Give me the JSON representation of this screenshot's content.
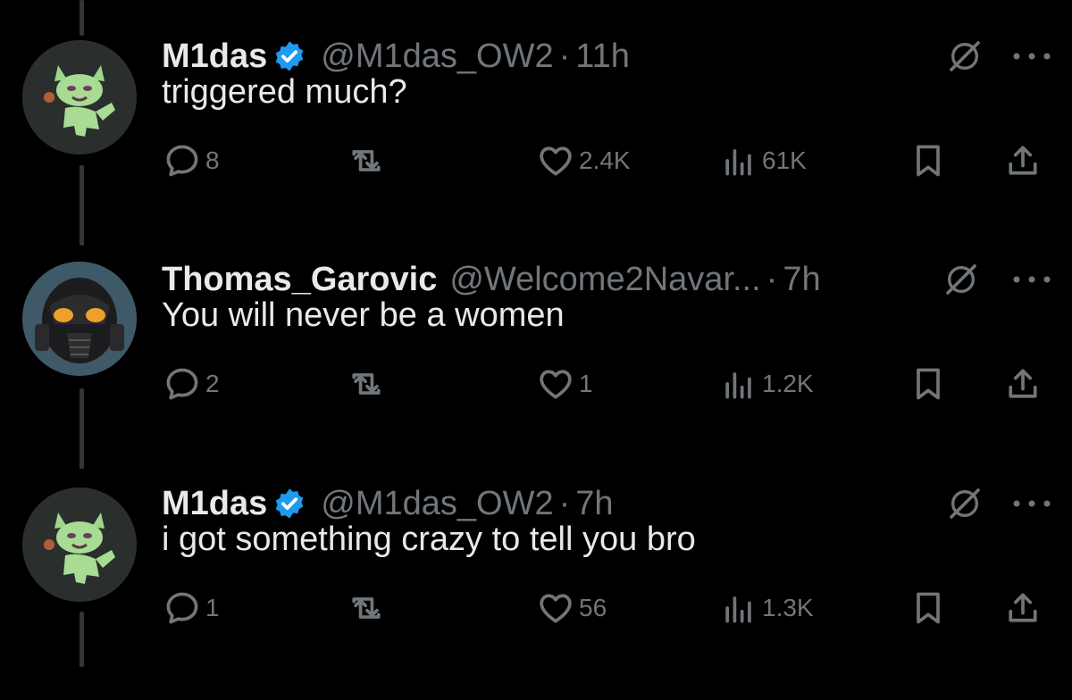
{
  "theme": {
    "background": "#000000",
    "text": "#e7e9ea",
    "muted": "#71767b",
    "verified": "#1d9bf0"
  },
  "tweets": [
    {
      "name": "M1das",
      "verified": true,
      "handle": "@M1das_OW2",
      "separator": "·",
      "time": "11h",
      "text": "triggered much?",
      "avatar": "green-cat-avatar",
      "replies": "8",
      "reposts": "",
      "likes": "2.4K",
      "views": "61K"
    },
    {
      "name": "Thomas_Garovic",
      "verified": false,
      "handle": "@Welcome2Navar...",
      "separator": "·",
      "time": "7h",
      "text": "You will never be a women",
      "avatar": "power-armor-helmet-avatar",
      "replies": "2",
      "reposts": "",
      "likes": "1",
      "views": "1.2K"
    },
    {
      "name": "M1das",
      "verified": true,
      "handle": "@M1das_OW2",
      "separator": "·",
      "time": "7h",
      "text": "i got something crazy to tell you bro",
      "avatar": "green-cat-avatar",
      "replies": "1",
      "reposts": "",
      "likes": "56",
      "views": "1.3K"
    }
  ],
  "icons": {
    "reply": "reply-icon",
    "repost": "repost-icon",
    "like": "heart-icon",
    "views": "views-icon",
    "bookmark": "bookmark-icon",
    "share": "share-icon",
    "grok": "grok-icon",
    "more": "more-icon",
    "verified": "verified-badge-icon"
  }
}
